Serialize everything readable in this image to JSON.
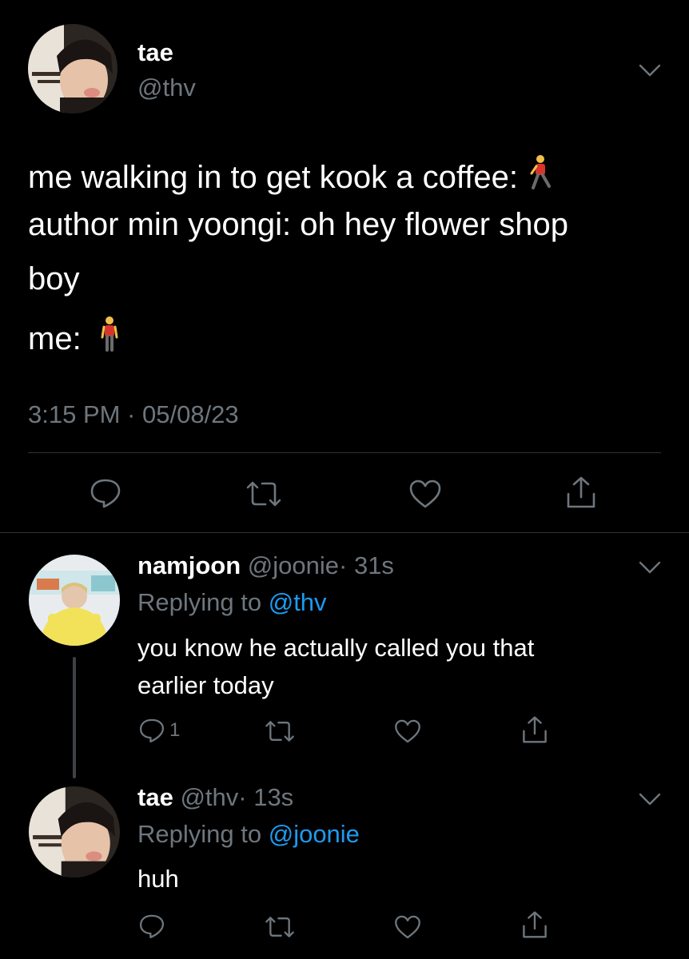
{
  "main_tweet": {
    "display_name": "tae",
    "handle": "@thv",
    "lines": [
      "me walking in to get kook a coffee:",
      "author min yoongi: oh hey flower shop",
      "boy",
      "me:"
    ],
    "emoji_line1": "person-walking",
    "emoji_line4": "person-standing",
    "timestamp": "3:15 PM · 05/08/23"
  },
  "replies": [
    {
      "display_name": "namjoon",
      "handle": "@joonie",
      "time": "· 31s",
      "replying_prefix": "Replying to",
      "replying_to": "@thv",
      "text_lines": [
        "you know he actually called you that",
        "earlier today"
      ],
      "reply_count": "1"
    },
    {
      "display_name": "tae",
      "handle": "@thv",
      "time": "· 13s",
      "replying_prefix": "Replying to",
      "replying_to": "@joonie",
      "text_lines": [
        "huh"
      ],
      "reply_count": ""
    }
  ],
  "icons": {
    "reply": "speech-bubble-icon",
    "retweet": "retweet-icon",
    "like": "heart-icon",
    "share": "share-icon",
    "more": "chevron-down-icon"
  },
  "colors": {
    "background": "#000000",
    "text": "#ffffff",
    "muted": "#6e767d",
    "link": "#1d9bf0",
    "divider": "#2f3336"
  }
}
